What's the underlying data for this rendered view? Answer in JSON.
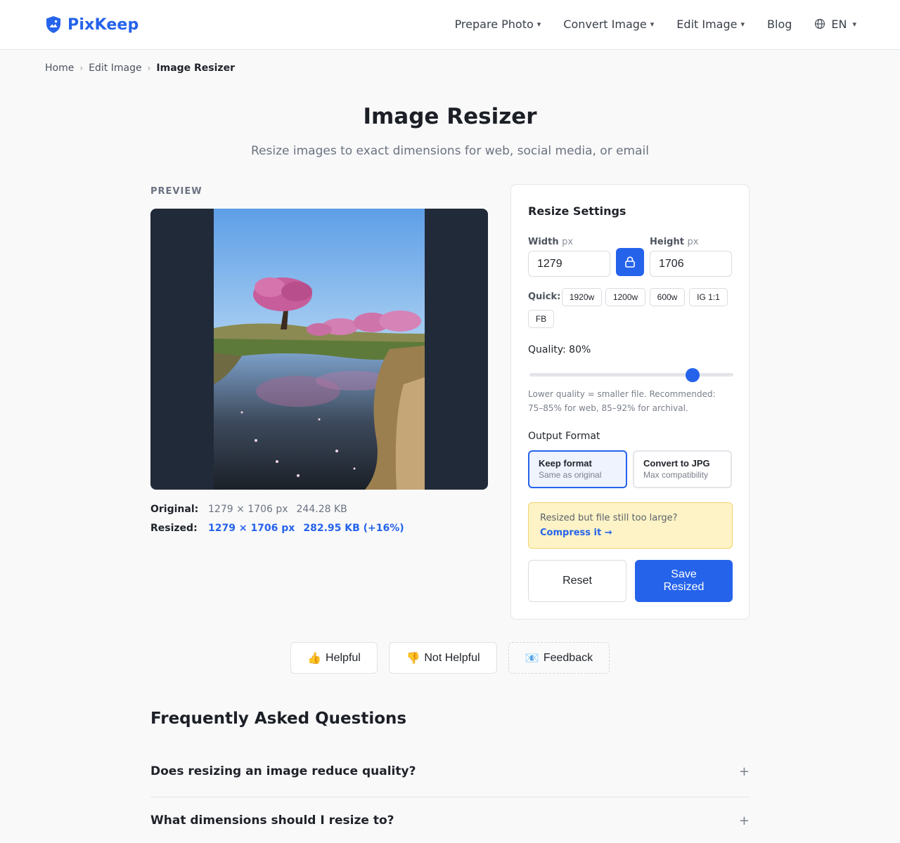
{
  "brand": {
    "name": "PixKeep",
    "accent": "#2563eb"
  },
  "nav": {
    "items": [
      {
        "label": "Prepare Photo",
        "caret": "▾"
      },
      {
        "label": "Convert Image",
        "caret": "▾"
      },
      {
        "label": "Edit Image",
        "caret": "▾"
      },
      {
        "label": "Blog"
      }
    ],
    "language": "EN",
    "language_caret": "▾"
  },
  "breadcrumb": {
    "home": "Home",
    "parent": "Edit Image",
    "current": "Image Resizer",
    "separator": "›"
  },
  "page": {
    "title": "Image Resizer",
    "subtitle": "Resize images to exact dimensions for web, social media, or email"
  },
  "preview": {
    "label": "PREVIEW",
    "original_label": "Original:",
    "original_dims": "1279 × 1706 px",
    "original_size": "244.28 KB",
    "resized_label": "Resized:",
    "resized_dims": "1279 × 1706 px",
    "resized_size": "282.95 KB (+16%)"
  },
  "settings": {
    "title": "Resize Settings",
    "width_label": "Width",
    "height_label": "Height",
    "unit": "px",
    "width_value": "1279",
    "height_value": "1706",
    "quick_label": "Quick:",
    "quick_presets": [
      "1920w",
      "1200w",
      "600w",
      "IG 1:1",
      "FB"
    ],
    "quality_label": "Quality: 80%",
    "quality_value": 80,
    "quality_help": "Lower quality = smaller file. Recommended: 75–85% for web, 85–92% for archival.",
    "format_label": "Output Format",
    "formats": [
      {
        "name": "Keep format",
        "desc": "Same as original",
        "selected": true
      },
      {
        "name": "Convert to JPG",
        "desc": "Max compatibility",
        "selected": false
      }
    ],
    "notice_text": "Resized but file still too large?",
    "notice_link": "Compress it →",
    "reset_label": "Reset",
    "save_label": "Save Resized"
  },
  "feedback": {
    "helpful": "Helpful",
    "helpful_icon": "👍",
    "not_helpful": "Not Helpful",
    "not_helpful_icon": "👎",
    "feedback": "Feedback",
    "feedback_icon": "📧"
  },
  "faq": {
    "title": "Frequently Asked Questions",
    "items": [
      {
        "question": "Does resizing an image reduce quality?",
        "toggle": "+"
      },
      {
        "question": "What dimensions should I resize to?",
        "toggle": "+"
      }
    ]
  }
}
